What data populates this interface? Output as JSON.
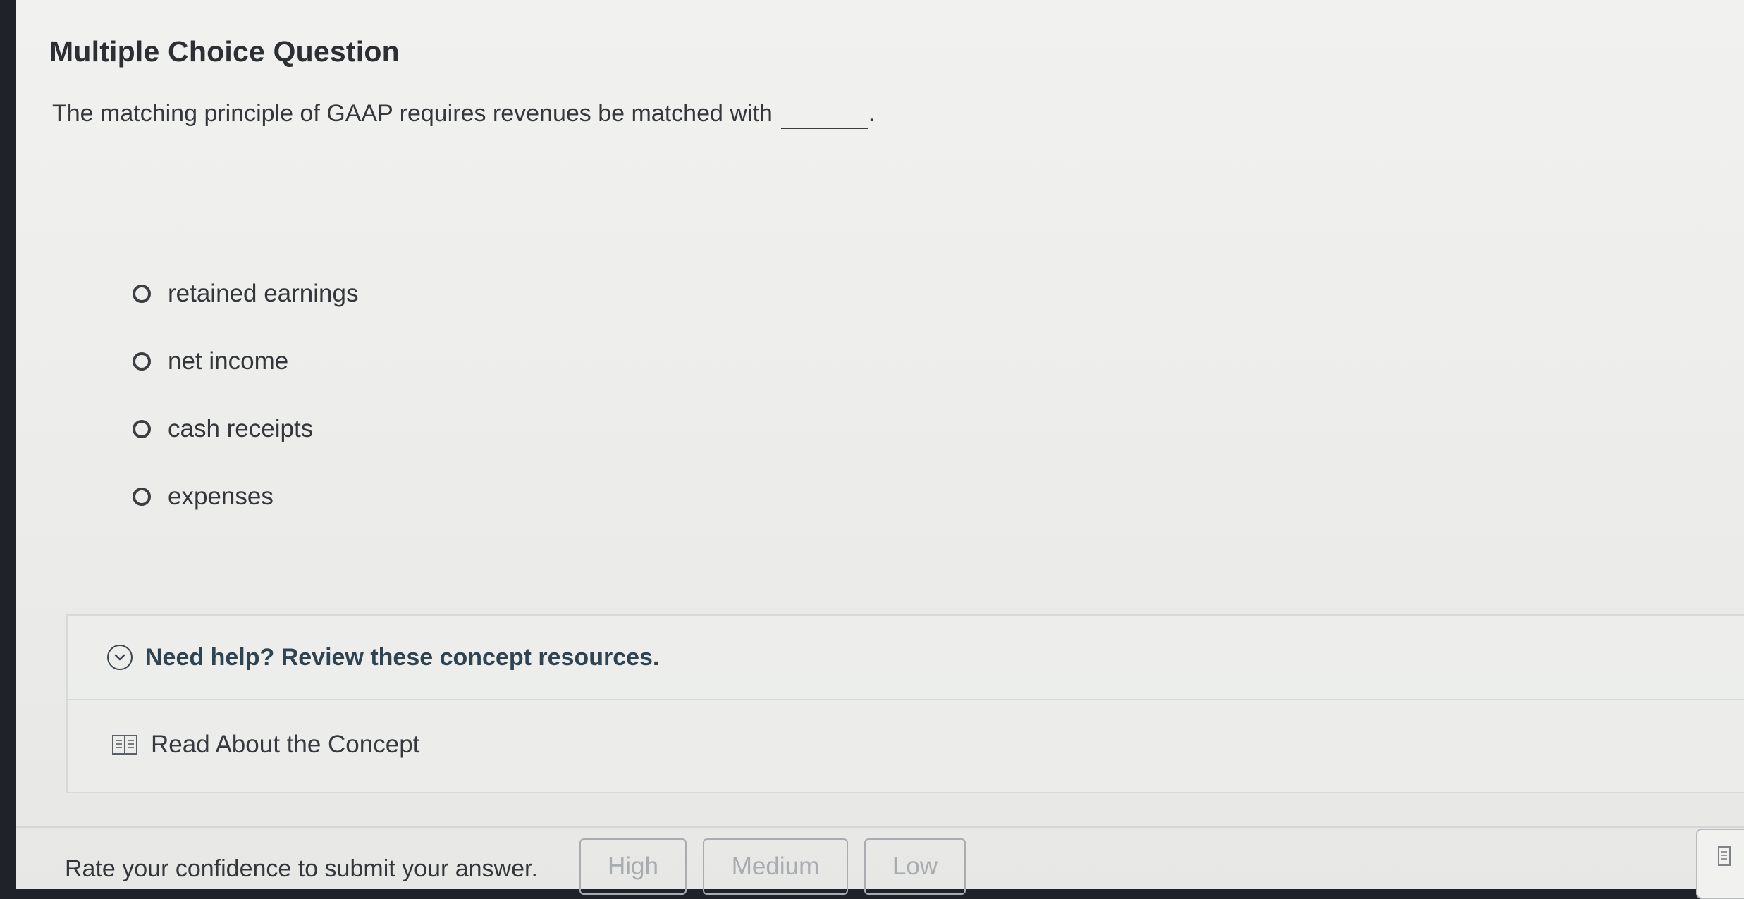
{
  "question": {
    "type_label": "Multiple Choice Question",
    "prompt": "The matching principle of GAAP requires revenues be matched with",
    "prompt_end": ".",
    "options": [
      {
        "label": "retained earnings"
      },
      {
        "label": "net income"
      },
      {
        "label": "cash receipts"
      },
      {
        "label": "expenses"
      }
    ]
  },
  "help": {
    "header": "Need help? Review these concept resources.",
    "resource_label": "Read About the Concept"
  },
  "confidence": {
    "prompt": "Rate your confidence to submit your answer.",
    "high_label": "High",
    "medium_label": "Medium",
    "low_label": "Low"
  },
  "icons": {
    "expand": "chevron-down-icon",
    "resource": "book-icon",
    "tool": "notebook-icon"
  },
  "colors": {
    "help_title": "#2f4453",
    "disabled_button": "#a8acb0"
  }
}
